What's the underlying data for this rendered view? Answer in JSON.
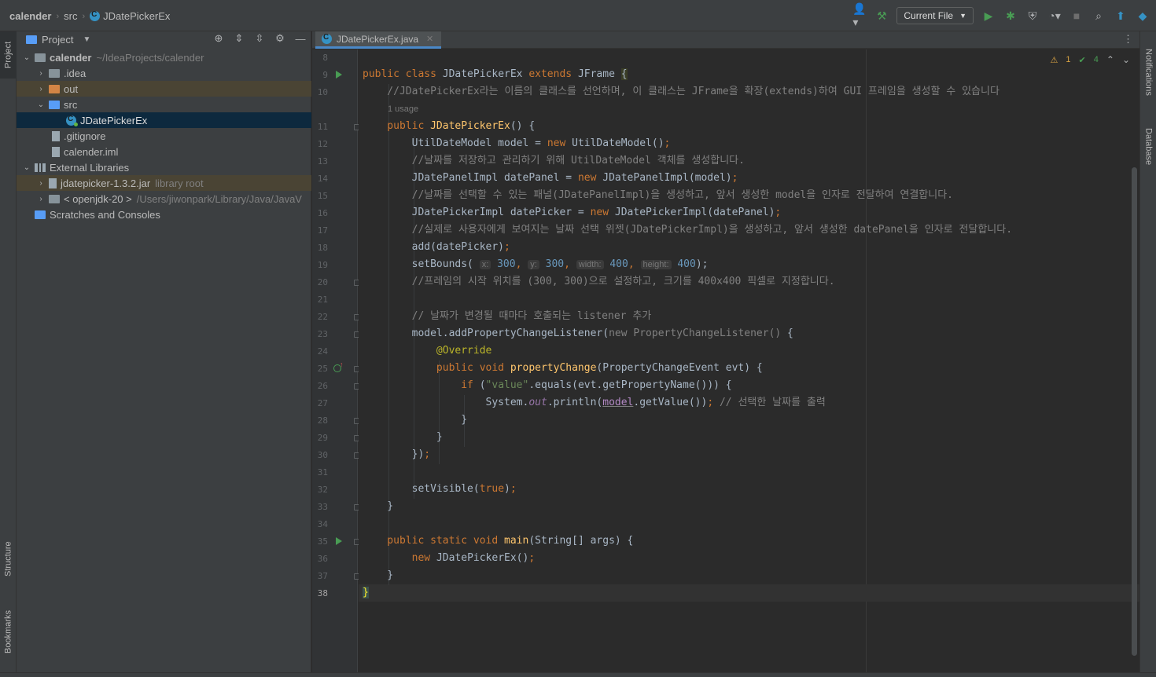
{
  "breadcrumb": {
    "project": "calender",
    "folder": "src",
    "file": "JDatePickerEx"
  },
  "toolbar": {
    "run_config": "Current File"
  },
  "side_tabs": {
    "project": "Project",
    "structure": "Structure",
    "bookmarks": "Bookmarks",
    "notifications": "Notifications",
    "database": "Database"
  },
  "project_panel": {
    "title": "Project",
    "tree": [
      {
        "label": "calender",
        "dim": "~/IdeaProjects/calender"
      },
      {
        "label": ".idea"
      },
      {
        "label": "out"
      },
      {
        "label": "src"
      },
      {
        "label": "JDatePickerEx"
      },
      {
        "label": ".gitignore"
      },
      {
        "label": "calender.iml"
      },
      {
        "label": "External Libraries"
      },
      {
        "label": "jdatepicker-1.3.2.jar",
        "dim": "library root"
      },
      {
        "label": "< openjdk-20 >",
        "dim": "/Users/jiwonpark/Library/Java/JavaV"
      },
      {
        "label": "Scratches and Consoles"
      }
    ]
  },
  "editor": {
    "tab_label": "JDatePickerEx.java",
    "inspection": {
      "warnings": "1",
      "checks": "4"
    },
    "line_numbers": [
      "8",
      "9",
      "10",
      "11",
      "12",
      "13",
      "14",
      "15",
      "16",
      "17",
      "18",
      "19",
      "20",
      "21",
      "22",
      "23",
      "24",
      "25",
      "26",
      "27",
      "28",
      "29",
      "30",
      "31",
      "32",
      "33",
      "34",
      "35",
      "36",
      "37",
      "38"
    ],
    "code": {
      "l9_a": "public class ",
      "l9_b": "JDatePickerEx ",
      "l9_c": "extends ",
      "l9_d": "JFrame ",
      "l9_e": "{",
      "l10": "    //JDatePickerEx라는 이름의 클래스를 선언하며, 이 클래스는 JFrame을 확장(extends)하여 GUI 프레임을 생성할 수 있습니다",
      "usage": "1 usage",
      "l11_a": "    public ",
      "l11_b": "JDatePickerEx",
      "l11_c": "() {",
      "l12_a": "        UtilDateModel model = ",
      "l12_b": "new ",
      "l12_c": "UtilDateModel()",
      "l12_d": ";",
      "l13": "        //날짜를 저장하고 관리하기 위해 UtilDateModel 객체를 생성합니다.",
      "l14_a": "        JDatePanelImpl datePanel = ",
      "l14_b": "new ",
      "l14_c": "JDatePanelImpl(model)",
      "l14_d": ";",
      "l15": "        //날짜를 선택할 수 있는 패널(JDatePanelImpl)을 생성하고, 앞서 생성한 model을 인자로 전달하여 연결합니다.",
      "l16_a": "        JDatePickerImpl datePicker = ",
      "l16_b": "new ",
      "l16_c": "JDatePickerImpl(datePanel)",
      "l16_d": ";",
      "l17": "        //실제로 사용자에게 보여지는 날짜 선택 위젯(JDatePickerImpl)을 생성하고, 앞서 생성한 datePanel을 인자로 전달합니다.",
      "l18_a": "        add(datePicker)",
      "l18_b": ";",
      "l19_a": "        setBounds( ",
      "h_x": "x:",
      "v_x": "300",
      "h_y": "y:",
      "v_y": "300",
      "h_w": "width:",
      "v_w": "400",
      "h_h": "height:",
      "v_h": "400",
      "l19_z": ");",
      "l20": "        //프레임의 시작 위치를 (300, 300)으로 설정하고, 크기를 400x400 픽셀로 지정합니다.",
      "l22": "        // 날짜가 변경될 때마다 호출되는 listener 추가",
      "l23_a": "        model.addPropertyChangeListener(",
      "l23_b": "new PropertyChangeListener()",
      "l23_c": " {",
      "l24": "            @Override",
      "l25_a": "            public void ",
      "l25_b": "propertyChange",
      "l25_c": "(PropertyChangeEvent evt) {",
      "l26_a": "                ",
      "l26_b": "if ",
      "l26_c": "(",
      "l26_d": "\"value\"",
      "l26_e": ".equals(evt.getPropertyName())) {",
      "l27_a": "                    System.",
      "l27_b": "out",
      "l27_c": ".println(",
      "l27_d": "model",
      "l27_e": ".getValue())",
      "l27_f": "; ",
      "l27_g": "// 선택한 날짜를 출력",
      "l28": "                }",
      "l29": "            }",
      "l30_a": "        })",
      "l30_b": ";",
      "l32_a": "        setVisible(",
      "l32_b": "true",
      "l32_c": ")",
      "l32_d": ";",
      "l33": "    }",
      "l35_a": "    public static void ",
      "l35_b": "main",
      "l35_c": "(String[] args) {",
      "l36_a": "        ",
      "l36_b": "new ",
      "l36_c": "JDatePickerEx()",
      "l36_d": ";",
      "l37": "    }",
      "l38": "}"
    }
  },
  "colors": {
    "keyword": "#cc7832",
    "method": "#ffc66d",
    "comment": "#808080",
    "string": "#6a8759",
    "number": "#6897bb",
    "annotation": "#bbb529",
    "field": "#9876aa",
    "selection": "#0d293e"
  }
}
